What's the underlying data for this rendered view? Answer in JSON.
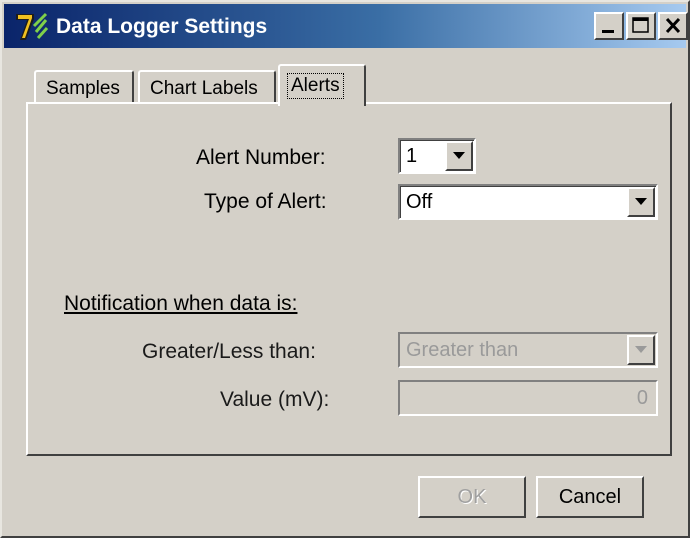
{
  "window": {
    "title": "Data Logger Settings",
    "title_bar_colors": [
      "#0a246a",
      "#a6caf0"
    ],
    "controls": [
      "minimize-icon",
      "maximize-icon",
      "close-icon"
    ]
  },
  "tabs": [
    {
      "label": "Samples",
      "active": false
    },
    {
      "label": "Chart Labels",
      "active": false
    },
    {
      "label": "Alerts",
      "active": true
    }
  ],
  "alerts": {
    "alert_number_label": "Alert Number:",
    "alert_number_value": "1",
    "type_label": "Type of Alert:",
    "type_value": "Off",
    "notification_heading": "Notification when data is:",
    "greater_less_label": "Greater/Less than:",
    "greater_less_value": "Greater than",
    "value_label": "Value (mV):",
    "value_value": "0"
  },
  "buttons": {
    "ok": "OK",
    "cancel": "Cancel"
  }
}
